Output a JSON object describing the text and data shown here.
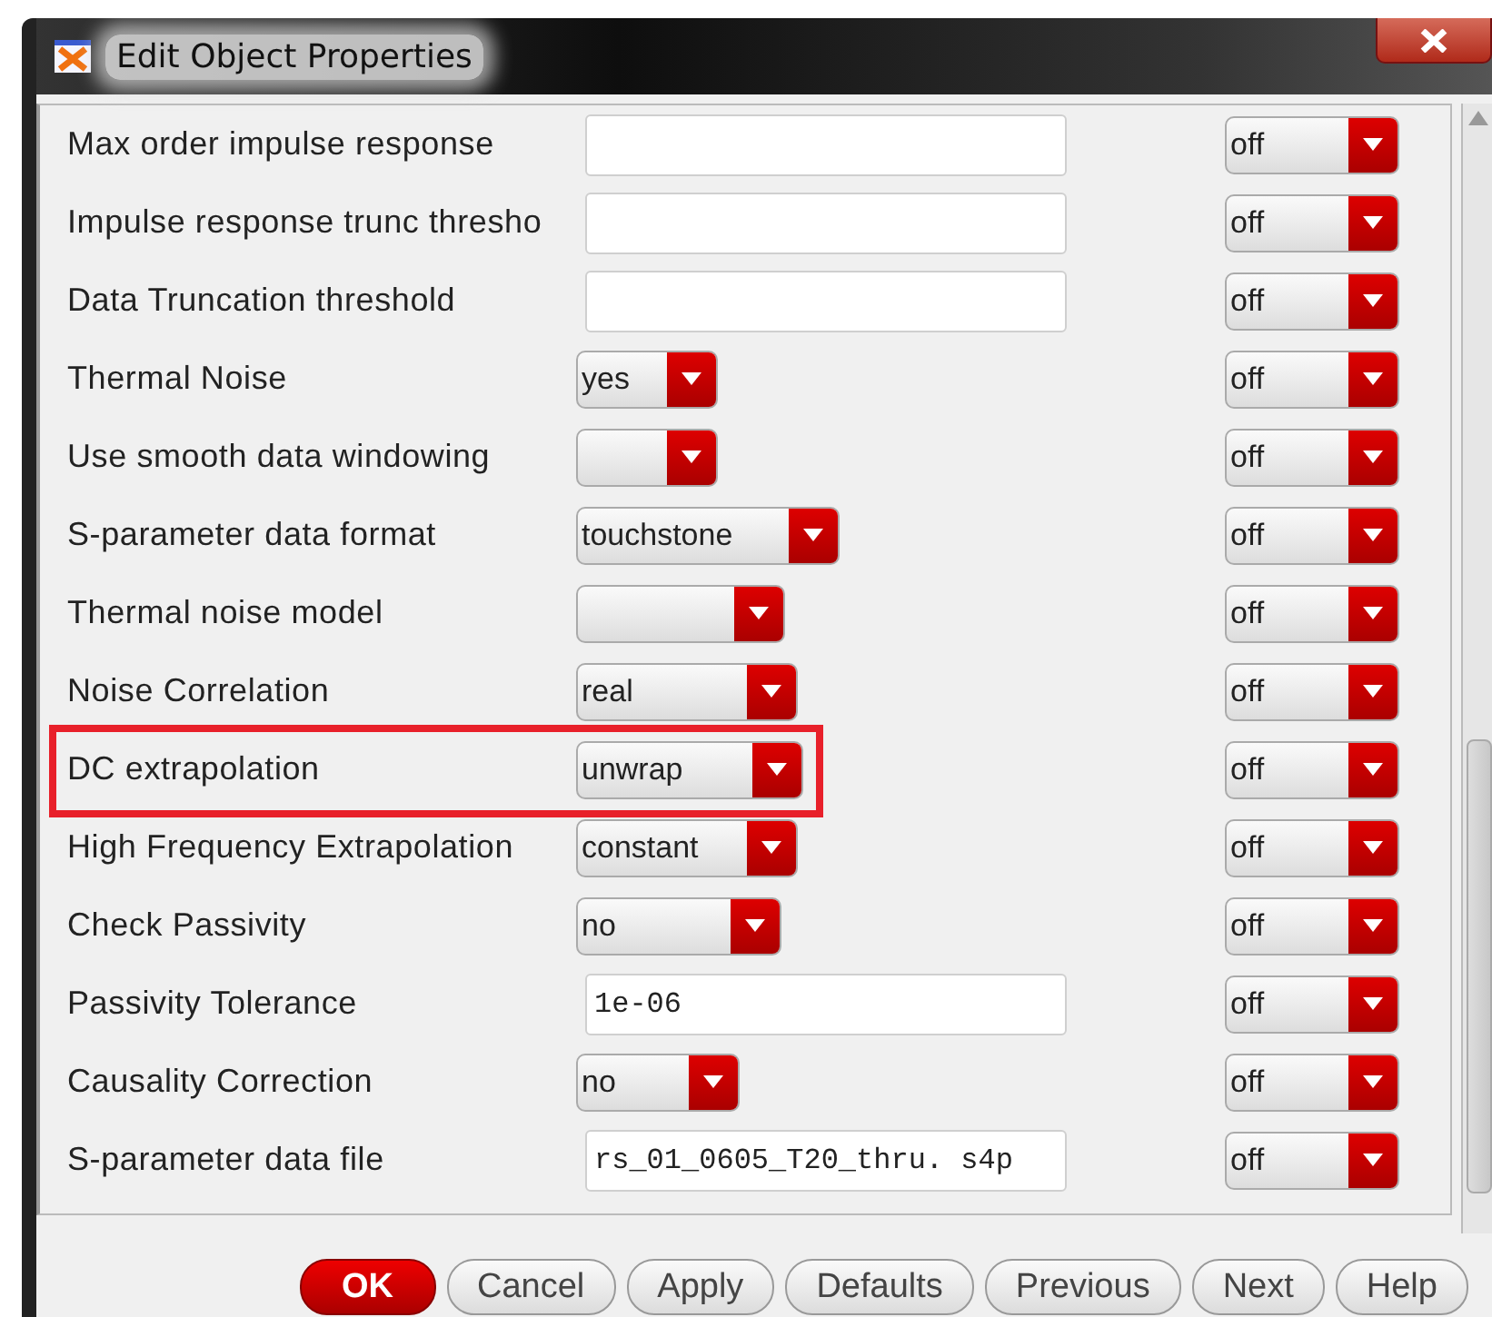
{
  "window": {
    "title": "Edit Object Properties"
  },
  "properties": [
    {
      "label": "Max order impulse response",
      "kind": "field",
      "toggle": "off",
      "highlighted": false
    },
    {
      "label": "Impulse response trunc thresho",
      "kind": "field",
      "toggle": "off",
      "highlighted": false
    },
    {
      "label": "Data Truncation threshold",
      "kind": "field",
      "toggle": "off",
      "highlighted": false
    },
    {
      "label": "Thermal Noise",
      "kind": "combo",
      "value": "yes",
      "toggle": "off",
      "highlighted": false
    },
    {
      "label": "Use smooth data windowing",
      "kind": "combo",
      "toggle": "off",
      "highlighted": false
    },
    {
      "label": "S-parameter data format",
      "kind": "combo",
      "value": "touchstone",
      "toggle": "off",
      "highlighted": false
    },
    {
      "label": "Thermal noise model",
      "kind": "combo",
      "toggle": "off",
      "highlighted": false
    },
    {
      "label": "Noise Correlation",
      "kind": "combo",
      "value": "real",
      "toggle": "off",
      "highlighted": false
    },
    {
      "label": "DC extrapolation",
      "kind": "combo",
      "value": "unwrap",
      "toggle": "off",
      "highlighted": true
    },
    {
      "label": "High Frequency Extrapolation",
      "kind": "combo",
      "value": "constant",
      "toggle": "off",
      "highlighted": false
    },
    {
      "label": "Check Passivity",
      "kind": "combo",
      "value": "no",
      "toggle": "off",
      "highlighted": false
    },
    {
      "label": "Passivity Tolerance",
      "kind": "field",
      "value": "1e-06",
      "toggle": "off",
      "highlighted": false
    },
    {
      "label": "Causality Correction",
      "kind": "combo",
      "value": "no",
      "toggle": "off",
      "highlighted": false
    },
    {
      "label": "S-parameter data file",
      "kind": "field",
      "value": "rs_01_0605_T20_thru. s4p",
      "toggle": "off",
      "highlighted": false
    }
  ],
  "buttons": [
    {
      "label": "OK",
      "default": true
    },
    {
      "label": "Cancel",
      "default": false
    },
    {
      "label": "Apply",
      "default": false
    },
    {
      "label": "Defaults",
      "default": false
    },
    {
      "label": "Previous",
      "default": false
    },
    {
      "label": "Next",
      "default": false
    },
    {
      "label": "Help",
      "default": false
    }
  ]
}
